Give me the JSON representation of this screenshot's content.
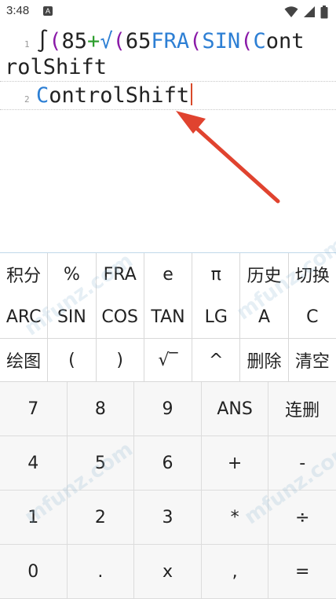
{
  "status_bar": {
    "time": "3:48",
    "a_icon": "A",
    "icons": [
      "wifi-icon",
      "signal-icon",
      "battery-icon"
    ]
  },
  "editor": {
    "line1": {
      "number": "1"
    },
    "line2": {
      "number": "2"
    }
  },
  "watermark": "mfunz.com",
  "keypad": {
    "function_rows": [
      [
        "积分",
        "%",
        "FRA",
        "e",
        "π",
        "历史",
        "切换"
      ],
      [
        "ARC",
        "SIN",
        "COS",
        "TAN",
        "LG",
        "A",
        "C"
      ],
      [
        "绘图",
        "(",
        ")",
        "√‾",
        "^",
        "删除",
        "清空"
      ]
    ],
    "number_rows": [
      [
        "7",
        "8",
        "9",
        "ANS",
        "连删"
      ],
      [
        "4",
        "5",
        "6",
        "+",
        "-"
      ],
      [
        "1",
        "2",
        "3",
        "*",
        "÷"
      ],
      [
        "0",
        ".",
        "x",
        ",",
        "="
      ]
    ]
  },
  "colors": {
    "paren": "#8a1aa8",
    "operator": "#2e9e2e",
    "function": "#2d7fd4",
    "cursor": "#d94a2a",
    "arrow": "#e0432f"
  }
}
